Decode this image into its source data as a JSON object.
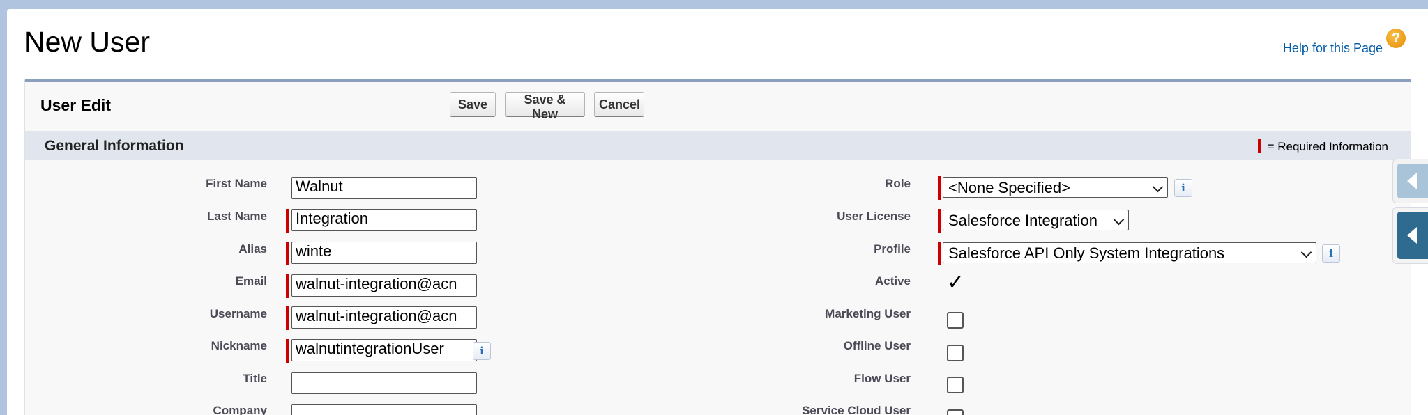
{
  "header": {
    "page_title": "New User",
    "help_link": "Help for this Page",
    "help_icon_glyph": "?"
  },
  "panel": {
    "title": "User Edit",
    "buttons": {
      "save": "Save",
      "save_new": "Save & New",
      "cancel": "Cancel"
    }
  },
  "section": {
    "title": "General Information",
    "required_legend": "= Required Information"
  },
  "left_fields": [
    {
      "label": "First Name",
      "value": "Walnut",
      "required": false
    },
    {
      "label": "Last Name",
      "value": "Integration",
      "required": true
    },
    {
      "label": "Alias",
      "value": "winte",
      "required": true
    },
    {
      "label": "Email",
      "value": "walnut-integration@acn",
      "required": true
    },
    {
      "label": "Username",
      "value": "walnut-integration@acn",
      "required": true
    },
    {
      "label": "Nickname",
      "value": "walnutintegrationUser",
      "required": true
    },
    {
      "label": "Title",
      "value": "",
      "required": false
    },
    {
      "label": "Company",
      "value": "",
      "required": false
    }
  ],
  "right_fields": {
    "role": {
      "label": "Role",
      "value": "<None Specified>"
    },
    "user_license": {
      "label": "User License",
      "value": "Salesforce Integration"
    },
    "profile": {
      "label": "Profile",
      "value": "Salesforce API Only System Integrations"
    },
    "active": {
      "label": "Active",
      "checked": true,
      "glyph": "✓"
    },
    "marketing_user": {
      "label": "Marketing User",
      "checked": false
    },
    "offline_user": {
      "label": "Offline User",
      "checked": false
    },
    "flow_user": {
      "label": "Flow User",
      "checked": false
    },
    "service_cloud_user": {
      "label": "Service Cloud User",
      "checked": false
    }
  },
  "info_icon_glyph": "i",
  "colors": {
    "required": "#cc0000",
    "link": "#015ba7",
    "panel_border": "#8a9ebe",
    "section_bg": "#e0e5ee",
    "side_tab_active": "#2f6b8f",
    "side_tab_inactive": "#a9c3d8"
  }
}
